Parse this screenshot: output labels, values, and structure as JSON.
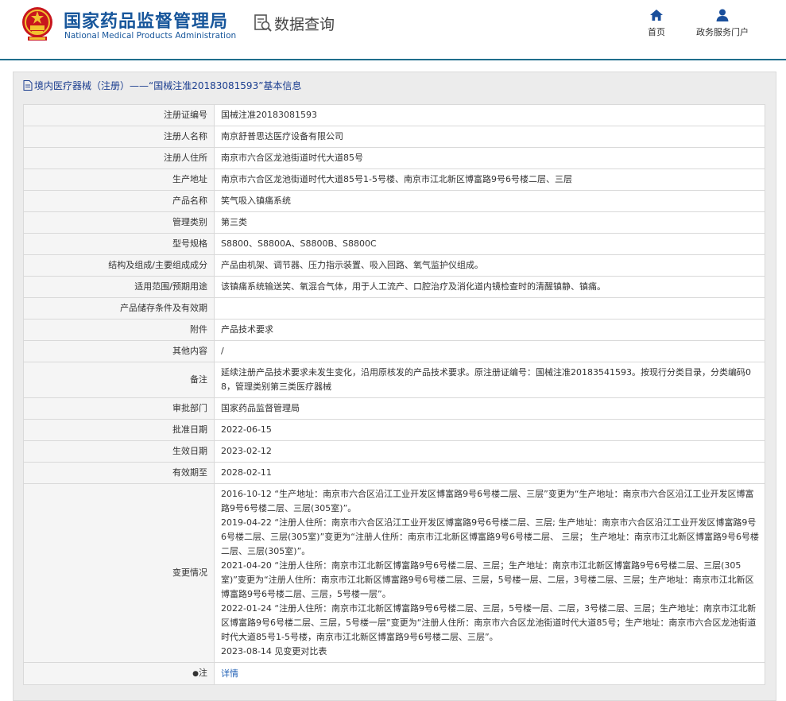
{
  "header": {
    "logo_cn": "国家药品监督管理局",
    "logo_en": "National Medical Products Administration",
    "query_label": "数据查询",
    "nav": [
      {
        "label": "首页",
        "icon": "home-icon"
      },
      {
        "label": "政务服务门户",
        "icon": "user-icon"
      }
    ],
    "colors": {
      "brand": "#17569b",
      "divider": "#1f6e8c"
    }
  },
  "panel": {
    "title": "境内医疗器械（注册）——“国械注准20183081593”基本信息"
  },
  "rows": [
    {
      "label": "注册证编号",
      "value": "国械注准20183081593"
    },
    {
      "label": "注册人名称",
      "value": "南京舒普思达医疗设备有限公司"
    },
    {
      "label": "注册人住所",
      "value": "南京市六合区龙池街道时代大道85号"
    },
    {
      "label": "生产地址",
      "value": "南京市六合区龙池街道时代大道85号1-5号楼、南京市江北新区博富路9号6号楼二层、三层"
    },
    {
      "label": "产品名称",
      "value": "笑气吸入镇痛系统"
    },
    {
      "label": "管理类别",
      "value": "第三类"
    },
    {
      "label": "型号规格",
      "value": "S8800、S8800A、S8800B、S8800C"
    },
    {
      "label": "结构及组成/主要组成成分",
      "value": "产品由机架、调节器、压力指示装置、吸入回路、氧气监护仪组成。"
    },
    {
      "label": "适用范围/预期用途",
      "value": "该镇痛系统输送笑、氧混合气体，用于人工流产、口腔治疗及消化道内镜检查时的清醒镇静、镇痛。"
    },
    {
      "label": "产品储存条件及有效期",
      "value": ""
    },
    {
      "label": "附件",
      "value": "产品技术要求"
    },
    {
      "label": "其他内容",
      "value": "/"
    },
    {
      "label": "备注",
      "value": "延续注册产品技术要求未发生变化，沿用原核发的产品技术要求。原注册证编号：国械注准20183541593。按现行分类目录，分类编码08，管理类别第三类医疗器械"
    },
    {
      "label": "审批部门",
      "value": "国家药品监督管理局"
    },
    {
      "label": "批准日期",
      "value": "2022-06-15"
    },
    {
      "label": "生效日期",
      "value": "2023-02-12"
    },
    {
      "label": "有效期至",
      "value": "2028-02-11"
    }
  ],
  "changes": {
    "label": "变更情况",
    "entries": [
      "2016-10-12 “生产地址：南京市六合区沿江工业开发区博富路9号6号楼二层、三层”变更为“生产地址：南京市六合区沿江工业开发区博富路9号6号楼二层、三层(305室)”。",
      "2019-04-22 “注册人住所：南京市六合区沿江工业开发区博富路9号6号楼二层、三层; 生产地址：南京市六合区沿江工业开发区博富路9号6号楼二层、三层(305室)”变更为“注册人住所：南京市江北新区博富路9号6号楼二层、 三层； 生产地址：南京市江北新区博富路9号6号楼二层、三层(305室)”。",
      "2021-04-20 “注册人住所：南京市江北新区博富路9号6号楼二层、三层；生产地址：南京市江北新区博富路9号6号楼二层、三层(305室)”变更为“注册人住所：南京市江北新区博富路9号6号楼二层、三层，5号楼一层、二层，3号楼二层、三层；生产地址：南京市江北新区博富路9号6号楼二层、三层，5号楼一层”。",
      "2022-01-24 “注册人住所：南京市江北新区博富路9号6号楼二层、三层，5号楼一层、二层，3号楼二层、三层；生产地址：南京市江北新区博富路9号6号楼二层、三层，5号楼一层”变更为“注册人住所：南京市六合区龙池街道时代大道85号；生产地址：南京市六合区龙池街道时代大道85号1-5号楼，南京市江北新区博富路9号6号楼二层、三层”。",
      "2023-08-14 见变更对比表"
    ]
  },
  "note": {
    "label": "注",
    "icon": "pin-icon",
    "link": "详情"
  }
}
